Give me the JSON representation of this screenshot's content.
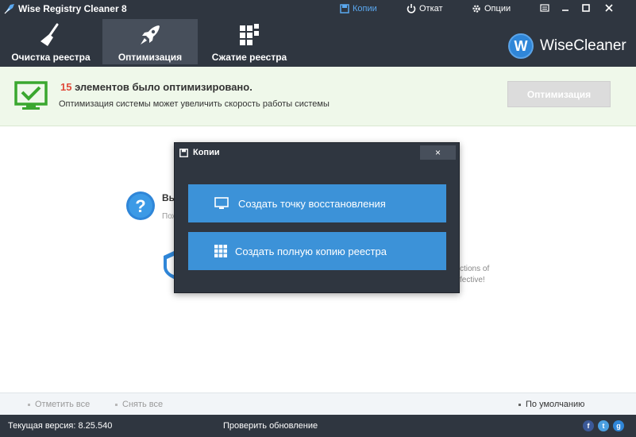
{
  "titlebar": {
    "app_title": "Wise Registry Cleaner 8",
    "backup_label": "Копии",
    "undo_label": "Откат",
    "options_label": "Опции"
  },
  "toolbar": {
    "cleaner_label": "Очистка реестра",
    "optimize_label": "Оптимизация",
    "compress_label": "Сжатие реестра",
    "brand_letter": "W",
    "brand_name": "WiseCleaner"
  },
  "banner": {
    "count": "15",
    "headline_rest": " элементов было оптимизировано.",
    "subline": "Оптимизация системы может увеличить скорость работы системы",
    "optimize_button": "Оптимизация"
  },
  "background": {
    "text1": "Вы",
    "text2": "Пож",
    "text3": "ctions of",
    "text4": "fective!"
  },
  "footer": {
    "select_all": "Отметить все",
    "deselect_all": "Снять все",
    "defaults": "По умолчанию"
  },
  "statusbar": {
    "version": "Текущая версия: 8.25.540",
    "check_update": "Проверить обновление"
  },
  "modal": {
    "title": "Копии",
    "close": "×",
    "restore_point": "Создать точку восстановления",
    "full_backup": "Создать полную копию реестра"
  },
  "colors": {
    "dark_bg": "#2f3640",
    "accent_blue": "#3c92d8",
    "count_red": "#e04a3a",
    "banner_bg": "#eff8ea",
    "check_green": "#3aa72f"
  },
  "icons": [
    "feather-icon",
    "save-icon",
    "undo-icon",
    "gear-icon",
    "broom-icon",
    "rocket-icon",
    "compress-icon",
    "check-monitor-icon",
    "question-icon",
    "shield-icon",
    "monitor-icon",
    "grid-icon",
    "close-icon"
  ]
}
